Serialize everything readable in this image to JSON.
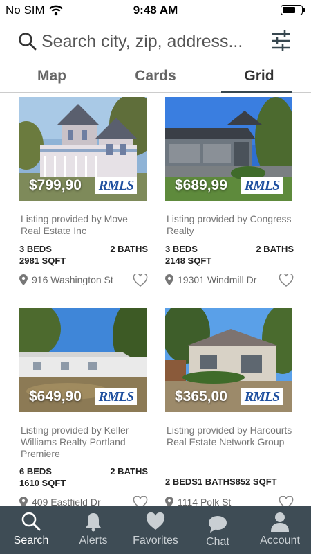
{
  "status_bar": {
    "carrier": "No SIM",
    "time": "9:48 AM",
    "battery_level": 0.7
  },
  "search": {
    "placeholder": "Search city, zip, address..."
  },
  "tabs": [
    {
      "label": "Map",
      "active": false
    },
    {
      "label": "Cards",
      "active": false
    },
    {
      "label": "Grid",
      "active": true
    }
  ],
  "listings": [
    {
      "price": "$799,90",
      "badge": "RMLS",
      "provider": "Listing provided by Move Real Estate Inc",
      "beds": "3 BEDS",
      "baths": "2 BATHS",
      "sqft": "2981 SQFT",
      "address": "916 Washington St"
    },
    {
      "price": "$689,99",
      "badge": "RMLS",
      "provider": "Listing provided by Congress Realty",
      "beds": "3 BEDS",
      "baths": "2 BATHS",
      "sqft": "2148 SQFT",
      "address": "19301 Windmill Dr"
    },
    {
      "price": "$649,90",
      "badge": "RMLS",
      "provider": "Listing provided by Keller Williams Realty Portland Premiere",
      "beds": "6 BEDS",
      "baths": "2 BATHS",
      "sqft": "1610 SQFT",
      "address": "409 Eastfield Dr"
    },
    {
      "price": "$365,00",
      "badge": "RMLS",
      "provider": "Listing provided by Harcourts Real Estate Network Group",
      "beds": "2 BEDS",
      "baths": "1 BATHS",
      "sqft": "852 SQFT",
      "address": "1114 Polk St"
    }
  ],
  "bottom_nav": [
    {
      "label": "Search",
      "icon": "search-icon",
      "active": true
    },
    {
      "label": "Alerts",
      "icon": "bell-icon",
      "active": false
    },
    {
      "label": "Favorites",
      "icon": "heart-icon",
      "active": false
    },
    {
      "label": "Chat",
      "icon": "chat-bubble-icon",
      "active": false
    },
    {
      "label": "Account",
      "icon": "person-icon",
      "active": false
    }
  ],
  "colors": {
    "nav_background": "#3e4c55",
    "tab_indicator": "#37474f",
    "badge_text": "#1d4e9e"
  }
}
